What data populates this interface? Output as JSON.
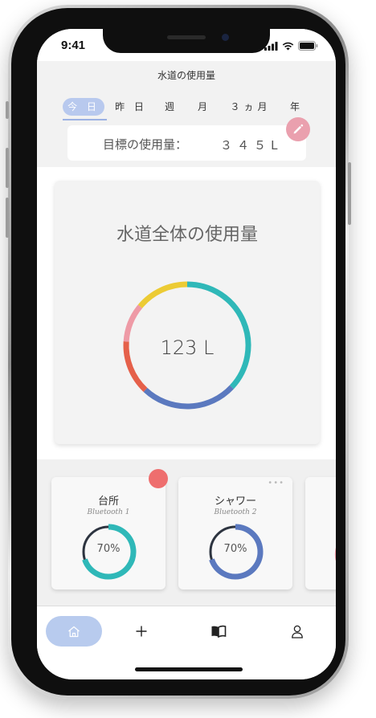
{
  "status_bar": {
    "time": "9:41"
  },
  "header": {
    "title": "水道の使用量",
    "tabs": [
      {
        "label": "今 日",
        "active": true
      },
      {
        "label": "昨 日",
        "active": false
      },
      {
        "label": "週",
        "active": false
      },
      {
        "label": "月",
        "active": false
      },
      {
        "label": "３ヵ月",
        "active": false
      },
      {
        "label": "年",
        "active": false
      }
    ],
    "goal_label": "目標の使用量：",
    "goal_value": "３４５L",
    "edit_icon": "pencil-icon"
  },
  "total": {
    "title": "水道全体の使用量",
    "value": "123 L",
    "ring_segments": [
      {
        "color": "#2fb8b8",
        "fraction": 0.37
      },
      {
        "color": "#5b79bf",
        "fraction": 0.25
      },
      {
        "color": "#e5604a",
        "fraction": 0.14
      },
      {
        "color": "#ee9aa6",
        "fraction": 0.1
      },
      {
        "color": "#eccb34",
        "fraction": 0.14
      }
    ]
  },
  "devices": [
    {
      "name": "台所",
      "subtitle": "Bluetooth 1",
      "percent": "70%",
      "fraction": 0.7,
      "color": "#2fb8b8"
    },
    {
      "name": "シャワー",
      "subtitle": "Bluetooth 2",
      "percent": "70%",
      "fraction": 0.7,
      "color": "#5b79bf"
    }
  ],
  "colors": {
    "accent": "#b8c9ee",
    "alert": "#ee6e6e",
    "edit_button": "#eaa0ae",
    "ring_track": "#2d3440"
  },
  "nav": {
    "items": [
      {
        "icon": "home-icon",
        "active": true
      },
      {
        "icon": "plus-icon",
        "active": false
      },
      {
        "icon": "book-icon",
        "active": false
      },
      {
        "icon": "user-icon",
        "active": false
      }
    ]
  }
}
